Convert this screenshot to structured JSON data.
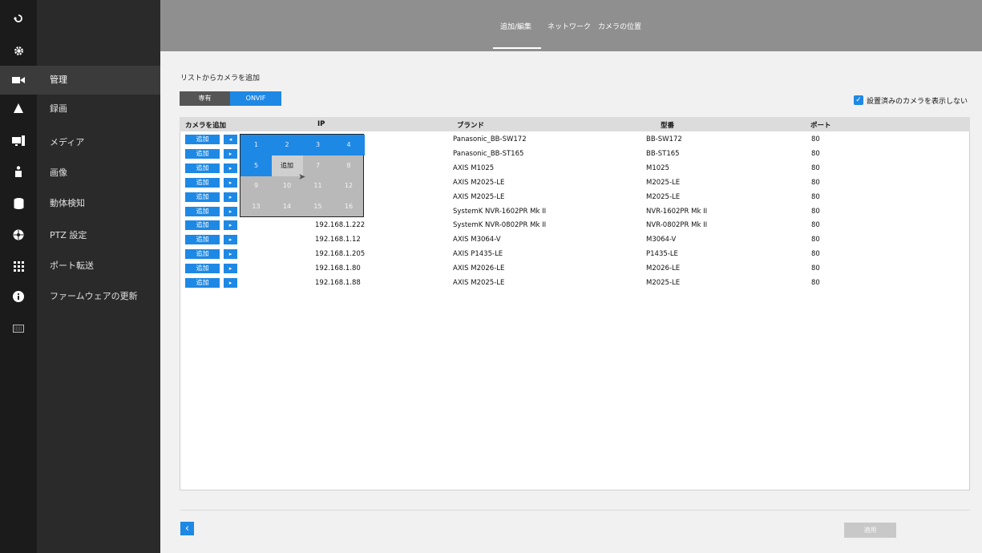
{
  "topbar": {
    "tabs": [
      {
        "label": "追加/編集"
      },
      {
        "label": "ネットワーク"
      },
      {
        "label": "カメラの位置"
      }
    ]
  },
  "rail": {
    "icons": [
      "back-icon",
      "settings-gear-icon",
      "camera-icon",
      "bell-icon",
      "display-icon",
      "user-icon",
      "database-icon",
      "ptz-icon",
      "grid-icon",
      "info-icon",
      "keyboard-icon"
    ]
  },
  "menu": {
    "items": [
      {
        "label": "管理"
      },
      {
        "label": "録画"
      },
      {
        "label": "メディア"
      },
      {
        "label": "画像"
      },
      {
        "label": "動体検知"
      },
      {
        "label": "PTZ 設定"
      },
      {
        "label": "ポート転送"
      },
      {
        "label": "ファームウェアの更新"
      }
    ]
  },
  "content": {
    "title": "リストからカメラを追加",
    "segments": [
      "専有",
      "ONVIF"
    ],
    "hide_installed_label": "設置済みのカメラを表示しない",
    "hide_installed_checked": true,
    "columns": [
      "カメラを追加",
      "IP",
      "ブランド",
      "型番",
      "ポート"
    ],
    "add_label": "追加",
    "rows": [
      {
        "ip": "",
        "brand": "Panasonic_BB-SW172",
        "model": "BB-SW172",
        "port": "80"
      },
      {
        "ip": "",
        "brand": "Panasonic_BB-ST165",
        "model": "BB-ST165",
        "port": "80"
      },
      {
        "ip": "",
        "brand": "AXIS M1025",
        "model": "M1025",
        "port": "80"
      },
      {
        "ip": "",
        "brand": "AXIS M2025-LE",
        "model": "M2025-LE",
        "port": "80"
      },
      {
        "ip": "",
        "brand": "AXIS M2025-LE",
        "model": "M2025-LE",
        "port": "80"
      },
      {
        "ip": "",
        "brand": "SystemK NVR-1602PR Mk II",
        "model": "NVR-1602PR Mk II",
        "port": "80"
      },
      {
        "ip": "192.168.1.222",
        "brand": "SystemK NVR-0802PR Mk II",
        "model": "NVR-0802PR Mk II",
        "port": "80"
      },
      {
        "ip": "192.168.1.12",
        "brand": "AXIS M3064-V",
        "model": "M3064-V",
        "port": "80"
      },
      {
        "ip": "192.168.1.205",
        "brand": "AXIS P1435-LE",
        "model": "P1435-LE",
        "port": "80"
      },
      {
        "ip": "192.168.1.80",
        "brand": "AXIS M2026-LE",
        "model": "M2026-LE",
        "port": "80"
      },
      {
        "ip": "192.168.1.88",
        "brand": "AXIS M2025-LE",
        "model": "M2025-LE",
        "port": "80"
      }
    ],
    "channel_grid": {
      "cells": [
        "1",
        "2",
        "3",
        "4",
        "5",
        "追加",
        "7",
        "8",
        "9",
        "10",
        "11",
        "12",
        "13",
        "14",
        "15",
        "16"
      ],
      "selected": [
        "1",
        "2",
        "3",
        "4",
        "5"
      ],
      "hovered": "追加"
    }
  },
  "footer": {
    "apply_label": "適用"
  },
  "colors": {
    "accent": "#1e88e5",
    "sidebar": "#2a2a2a",
    "topbar": "#8f8f8f"
  }
}
